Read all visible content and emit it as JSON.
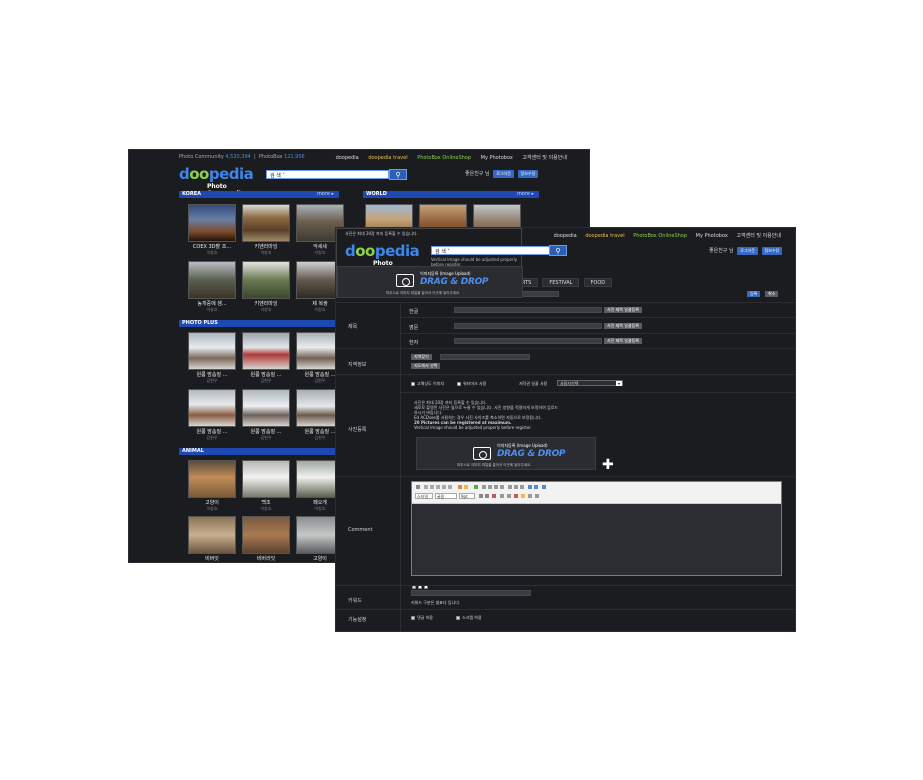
{
  "back": {
    "topbar": {
      "left_label": "Photo Community",
      "left_count": "4,520,394",
      "left_label2": "PhotoBox",
      "left_count2": "121,956",
      "links": [
        "doopedia",
        "doopedia travel",
        "PhotoBox OnlineShop",
        "My Photobox",
        "고객센터 및 이용안내"
      ]
    },
    "logo_main": "doopedia",
    "logo_sub": "Photo Community",
    "search_placeholder": "검 색 ˅",
    "user_greeting": "좋은친구 님",
    "login_button": "로그아웃",
    "join_button": "정보수정",
    "sections": {
      "korea": "KOREA",
      "world": "WORLD",
      "more": "more ▸",
      "photo_plus": "PHOTO PLUS",
      "animal": "ANIMAL"
    },
    "korea_items": [
      {
        "title": "COEX 3D촬 조...",
        "author": "이창호"
      },
      {
        "title": "키엔라마잉",
        "author": "이창호"
      },
      {
        "title": "악세세",
        "author": "이창호"
      },
      {
        "title": "농개중에 샘...",
        "author": "이창호"
      },
      {
        "title": "키엔라마잉",
        "author": "이창호"
      },
      {
        "title": "제 복쌍",
        "author": "이창호"
      }
    ],
    "plus_items": [
      {
        "title": "원룸 맘솜질 ...",
        "author": "김현우"
      },
      {
        "title": "원룸 맘솜질 ...",
        "author": "김현우"
      },
      {
        "title": "원룸 맘솜질 ...",
        "author": "김현우"
      },
      {
        "title": "원룸 맘솜질 ...",
        "author": "김현우"
      },
      {
        "title": "원룸 맘솜질 ...",
        "author": "김현우"
      },
      {
        "title": "원룸 맘솜질 ...",
        "author": "김현우"
      }
    ],
    "animal_items": [
      {
        "title": "고양이",
        "author": "이창호"
      },
      {
        "title": "백조",
        "author": "이창호"
      },
      {
        "title": "페오게",
        "author": "이창호"
      },
      {
        "title": "비버잇",
        "author": ""
      },
      {
        "title": "비버라잇",
        "author": ""
      },
      {
        "title": "고양이",
        "author": ""
      }
    ]
  },
  "front": {
    "topbar_links": [
      "doopedia",
      "doopedia travel",
      "PhotoBox OnlineShop",
      "My Photobox",
      "고객센터 및 이용안내"
    ],
    "user_greeting": "좋은친구 님",
    "login_button": "로그아웃",
    "join_button": "정보수정",
    "search_placeholder": "검 색 ˅",
    "tabs": [
      "ORTS",
      "FESTIVAL",
      "FOOD"
    ],
    "confirm_button": "등록",
    "cancel_button": "취소",
    "rows": {
      "title": "제목",
      "location": "지역정보",
      "register": "사진등록",
      "comment": "Comment",
      "keyword": "키워드",
      "feature": "기능설정"
    },
    "title_fields": [
      {
        "label": "한글",
        "btn": "사진 제목 일괄등록"
      },
      {
        "label": "영문",
        "btn": "사진 제목 일괄등록"
      },
      {
        "label": "한자",
        "btn": "사진 제목 일괄등록"
      }
    ],
    "location_btn1": "지역찾기",
    "location_btn2": "지도에서 선택",
    "options": {
      "hd": "고해상도 이미지",
      "watermark": "워터마크 사용",
      "license_label": "저작권 일괄 사용",
      "license_value": "사용자선택"
    },
    "notes": [
      "사진은 최대 20장 까지 등록할 수 있습니다.",
      "세로로 촬영된 사진은 옆으로 누울 수 있습니다. 사진 방향을 적절하게 보정하여 업로드",
      "하시기 바랍니다.",
      "Ed ACDsee를 사용하는 경우 사진 사이즈를 축소하면 자동으로 보정됩니다.",
      "20 Pictures can be registered at maximum.",
      "Vertical Image should be adjusted properly before register."
    ],
    "notes_bold": "최대 20장 까지",
    "drop": {
      "title": "이미지등록 (Image Upload)",
      "main": "DRAG & DROP",
      "hint": "마우스로 이미지 파일을 끌어서 이곳에 놓아주세요"
    },
    "editor": {
      "font": "굴림",
      "size": "9pt",
      "style": "스타일"
    },
    "keyword_hint": "키워드 구분은 쉼표다 입니다.",
    "feature": {
      "reply": "댓글 허용",
      "scrap": "스크랩 허용"
    }
  }
}
